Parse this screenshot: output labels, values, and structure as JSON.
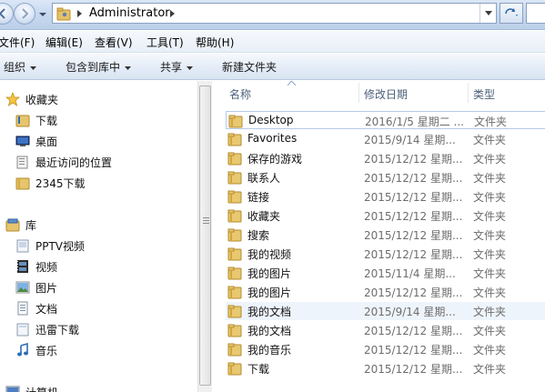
{
  "address_bar": {
    "path": "Administrator"
  },
  "menu": [
    {
      "label": "文件(F)"
    },
    {
      "label": "编辑(E)"
    },
    {
      "label": "查看(V)"
    },
    {
      "label": "工具(T)"
    },
    {
      "label": "帮助(H)"
    }
  ],
  "toolbar": {
    "organize": "组织",
    "include_in_library": "包含到库中",
    "share": "共享",
    "new_folder": "新建文件夹"
  },
  "nav": {
    "favorites": {
      "title": "收藏夹",
      "items": [
        {
          "label": "下载",
          "icon": "download-folder-icon"
        },
        {
          "label": "桌面",
          "icon": "desktop-icon"
        },
        {
          "label": "最近访问的位置",
          "icon": "recent-places-icon"
        },
        {
          "label": "2345下载",
          "icon": "folder-icon"
        }
      ]
    },
    "libraries": {
      "title": "库",
      "items": [
        {
          "label": "PPTV视频",
          "icon": "pptv-video-library-icon"
        },
        {
          "label": "视频",
          "icon": "video-library-icon"
        },
        {
          "label": "图片",
          "icon": "pictures-library-icon"
        },
        {
          "label": "文档",
          "icon": "documents-library-icon"
        },
        {
          "label": "迅雷下载",
          "icon": "xunlei-download-library-icon"
        },
        {
          "label": "音乐",
          "icon": "music-library-icon"
        }
      ]
    },
    "computer": {
      "title": "计算机"
    }
  },
  "columns": {
    "name": "名称",
    "date_modified": "修改日期",
    "type": "类型"
  },
  "files": [
    {
      "name": "Desktop",
      "date": "2016/1/5 星期二 ...",
      "type": "文件夹",
      "icon": "desktop-folder-icon",
      "state": "selected"
    },
    {
      "name": "Favorites",
      "date": "2015/9/14 星期...",
      "type": "文件夹",
      "icon": "folder-icon"
    },
    {
      "name": "保存的游戏",
      "date": "2015/12/12 星期...",
      "type": "文件夹",
      "icon": "saved-games-folder-icon"
    },
    {
      "name": "联系人",
      "date": "2015/12/12 星期...",
      "type": "文件夹",
      "icon": "contacts-folder-icon"
    },
    {
      "name": "链接",
      "date": "2015/12/12 星期...",
      "type": "文件夹",
      "icon": "links-folder-icon"
    },
    {
      "name": "收藏夹",
      "date": "2015/12/12 星期...",
      "type": "文件夹",
      "icon": "favorites-folder-icon"
    },
    {
      "name": "搜索",
      "date": "2015/12/12 星期...",
      "type": "文件夹",
      "icon": "searches-folder-icon"
    },
    {
      "name": "我的视频",
      "date": "2015/12/12 星期...",
      "type": "文件夹",
      "icon": "videos-folder-icon"
    },
    {
      "name": "我的图片",
      "date": "2015/11/4 星期...",
      "type": "文件夹",
      "icon": "pictures-folder-icon"
    },
    {
      "name": "我的图片",
      "date": "2015/12/12 星期...",
      "type": "文件夹",
      "icon": "pictures-folder-icon"
    },
    {
      "name": "我的文档",
      "date": "2015/9/14 星期...",
      "type": "文件夹",
      "icon": "folder-icon",
      "state": "hover"
    },
    {
      "name": "我的文档",
      "date": "2015/12/12 星期...",
      "type": "文件夹",
      "icon": "documents-folder-icon"
    },
    {
      "name": "我的音乐",
      "date": "2015/12/12 星期...",
      "type": "文件夹",
      "icon": "music-folder-icon"
    },
    {
      "name": "下载",
      "date": "2015/12/12 星期...",
      "type": "文件夹",
      "icon": "downloads-folder-icon"
    }
  ]
}
